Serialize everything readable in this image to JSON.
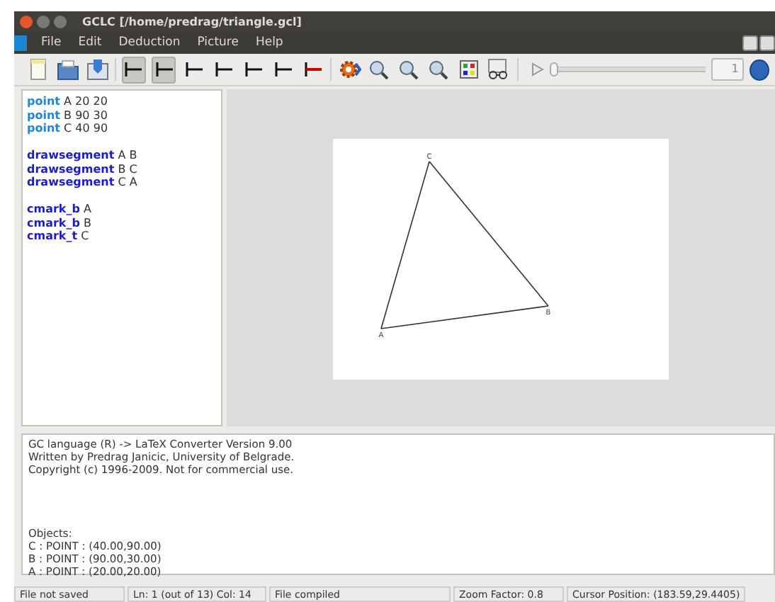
{
  "window": {
    "title": "GCLC [/home/predrag/triangle.gcl]"
  },
  "menu": [
    "File",
    "Edit",
    "Deduction",
    "Picture",
    "Help"
  ],
  "toolbar": {
    "files": [
      {
        "kind": "new"
      },
      {
        "kind": "open"
      },
      {
        "kind": "save"
      }
    ],
    "modes": [
      {
        "kind": "mode",
        "selected": true
      },
      {
        "kind": "mode",
        "selected": true
      },
      {
        "kind": "mode",
        "selected": false
      },
      {
        "kind": "mode",
        "selected": false
      },
      {
        "kind": "mode",
        "selected": false
      },
      {
        "kind": "mode",
        "selected": false
      },
      {
        "kind": "mode-red",
        "selected": false
      }
    ],
    "tools": [
      {
        "kind": "gear"
      },
      {
        "kind": "zoom"
      },
      {
        "kind": "zoom"
      },
      {
        "kind": "zoom"
      },
      {
        "kind": "grid"
      },
      {
        "kind": "glasses"
      }
    ]
  },
  "player": {
    "level": 0,
    "value": "1"
  },
  "editor": {
    "blocks": [
      [
        {
          "keyword": "point",
          "args": "A 20 20",
          "kind": "point"
        },
        {
          "keyword": "point",
          "args": "B 90 30",
          "kind": "point"
        },
        {
          "keyword": "point",
          "args": "C 40 90",
          "kind": "point"
        }
      ],
      [
        {
          "keyword": "drawsegment",
          "args": "A B",
          "kind": "command"
        },
        {
          "keyword": "drawsegment",
          "args": "B C",
          "kind": "command"
        },
        {
          "keyword": "drawsegment",
          "args": "C A",
          "kind": "command"
        }
      ],
      [
        {
          "keyword": "cmark_b",
          "args": "A",
          "kind": "command"
        },
        {
          "keyword": "cmark_b",
          "args": "B",
          "kind": "command"
        },
        {
          "keyword": "cmark_t",
          "args": "C",
          "kind": "command"
        }
      ]
    ]
  },
  "picture": {
    "points": [
      {
        "label": "A"
      },
      {
        "label": "B"
      },
      {
        "label": "C"
      }
    ]
  },
  "output": {
    "header": [
      "GC language (R) -> LaTeX  Converter  Version 9.00",
      "Written by Predrag Janicic, University of Belgrade.",
      "Copyright (c) 1996-2009. Not for commercial use."
    ],
    "objects": [
      "Objects:",
      "C : POINT : (40.00,90.00)",
      "B : POINT : (90.00,30.00)",
      "A : POINT : (20.00,20.00)"
    ]
  },
  "status_bar": [
    "File not saved",
    "Ln: 1 (out of 13) Col: 14",
    "File compiled",
    "Zoom Factor: 0.8",
    "Cursor Position: (183.59,29.4405)"
  ]
}
